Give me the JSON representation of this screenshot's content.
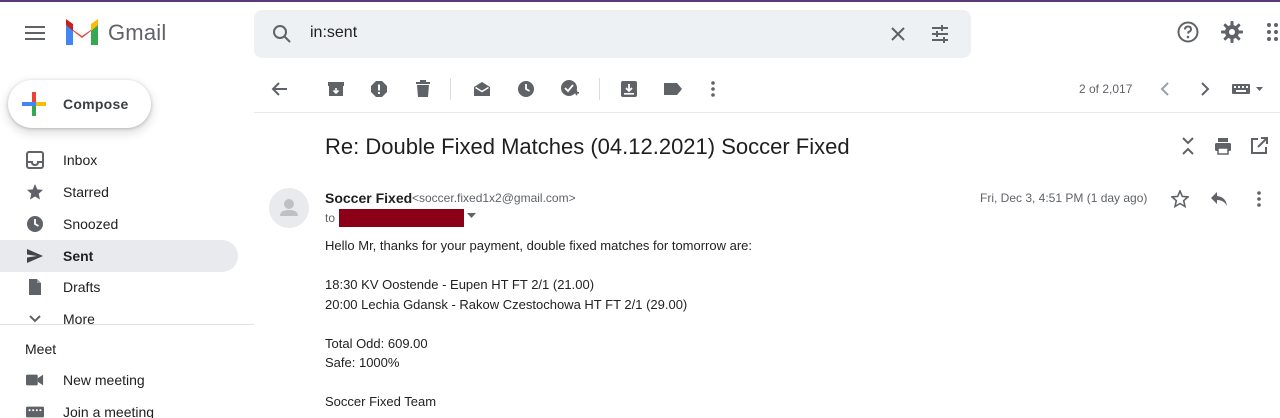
{
  "app": {
    "name": "Gmail"
  },
  "search": {
    "query": "in:sent"
  },
  "compose": {
    "label": "Compose"
  },
  "sidebar": {
    "items": [
      {
        "label": "Inbox",
        "icon": "inbox-icon"
      },
      {
        "label": "Starred",
        "icon": "star-icon"
      },
      {
        "label": "Snoozed",
        "icon": "clock-icon"
      },
      {
        "label": "Sent",
        "icon": "send-icon",
        "active": true
      },
      {
        "label": "Drafts",
        "icon": "draft-icon"
      },
      {
        "label": "More",
        "icon": "chevron-down-icon"
      }
    ],
    "meet": {
      "title": "Meet",
      "items": [
        {
          "label": "New meeting",
          "icon": "video-icon"
        },
        {
          "label": "Join a meeting",
          "icon": "keyboard-icon"
        }
      ]
    }
  },
  "toolbar": {
    "page_count": "2 of 2,017"
  },
  "message": {
    "subject": "Re: Double Fixed Matches (04.12.2021) Soccer Fixed",
    "sender_name": "Soccer Fixed",
    "sender_email": "<soccer.fixed1x2@gmail.com>",
    "to_label": "to",
    "date": "Fri, Dec 3, 4:51 PM (1 day ago)",
    "body": [
      "Hello Mr, thanks for your payment, double fixed matches for tomorrow are:",
      "18:30 KV Oostende - Eupen HT FT 2/1 (21.00)",
      "20:00 Lechia Gdansk - Rakow Czestochowa HT FT 2/1 (29.00)",
      "Total Odd: 609.00",
      "Safe: 1000%",
      "Soccer Fixed Team"
    ]
  },
  "colors": {
    "active_nav_bg": "#e8eaed",
    "search_bg": "#eef1f4",
    "redaction": "#8b0016",
    "icon_gray": "#5f6368"
  }
}
